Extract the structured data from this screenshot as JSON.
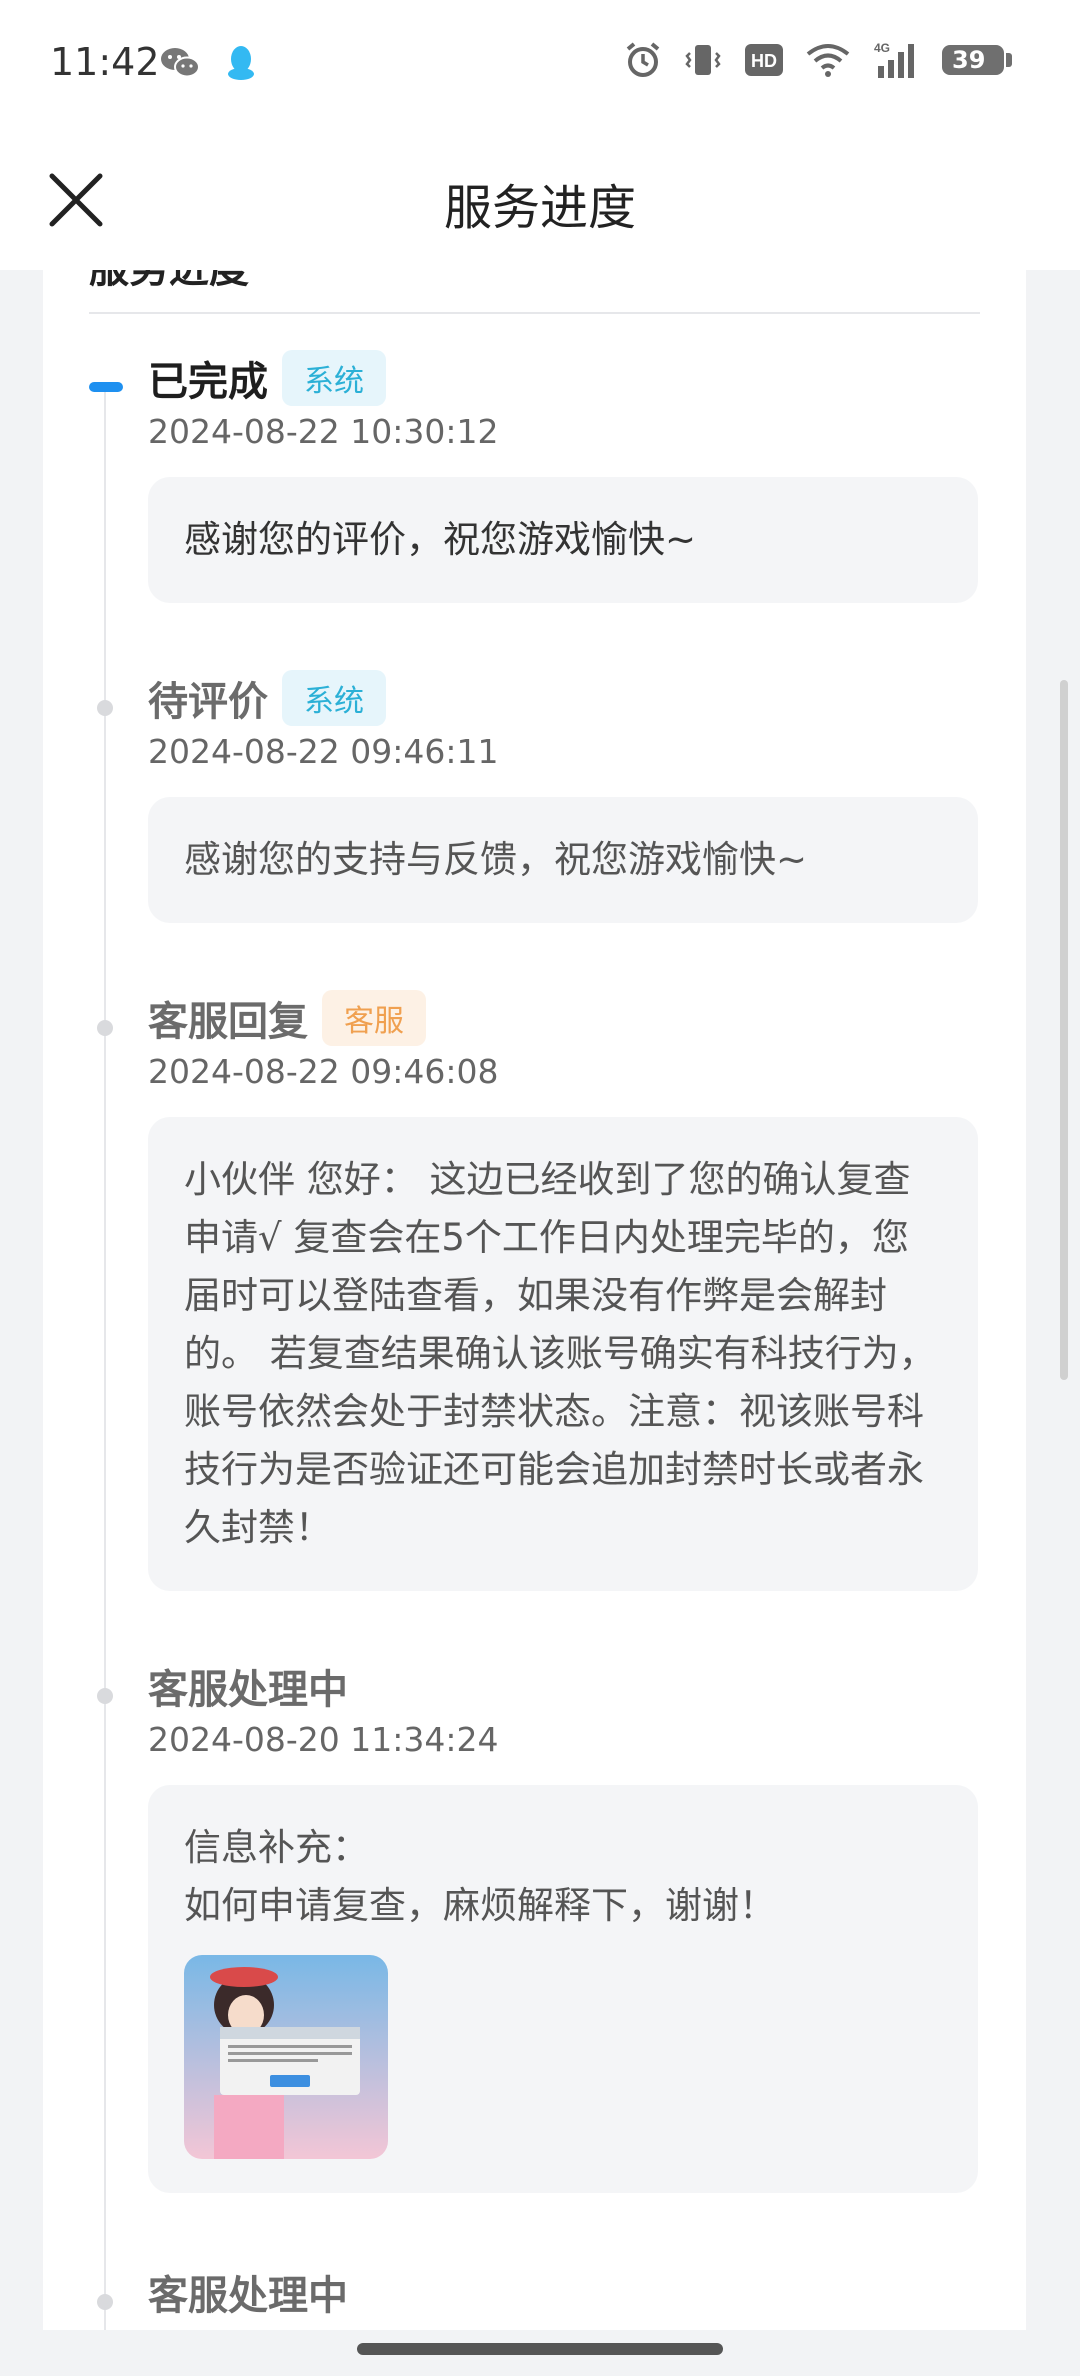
{
  "status_bar": {
    "time": "11:42",
    "left_icons": [
      "wechat-icon",
      "qq-icon"
    ],
    "right_icons": [
      "alarm-icon",
      "vibrate-icon",
      "hd-icon",
      "wifi-icon",
      "signal-4g-icon"
    ],
    "hd_label": "HD",
    "network_label": "4G",
    "battery": "39"
  },
  "header": {
    "title": "服务进度",
    "close_icon": "close-icon"
  },
  "card": {
    "section_heading": "服务进度"
  },
  "timeline": [
    {
      "status": "已完成",
      "tag": "系统",
      "tag_type": "system",
      "time": "2024-08-22 10:30:12",
      "message": "感谢您的评价，祝您游戏愉快~",
      "active": true
    },
    {
      "status": "待评价",
      "tag": "系统",
      "tag_type": "system",
      "time": "2024-08-22 09:46:11",
      "message": "感谢您的支持与反馈，祝您游戏愉快~",
      "active": false
    },
    {
      "status": "客服回复",
      "tag": "客服",
      "tag_type": "service",
      "time": "2024-08-22 09:46:08",
      "message": "小伙伴 您好： 这边已经收到了您的确认复查申请√ 复查会在5个工作日内处理完毕的，您届时可以登陆查看，如果没有作弊是会解封的。 若复查结果确认该账号确实有科技行为，账号依然会处于封禁状态。注意：视该账号科技行为是否验证还可能会追加封禁时长或者永久封禁！",
      "active": false
    },
    {
      "status": "客服处理中",
      "tag": "",
      "time": "2024-08-20 11:34:24",
      "message_label": "信息补充：",
      "message": "如何申请复查，麻烦解释下，谢谢！",
      "has_image": true,
      "active": false
    },
    {
      "status": "客服处理中",
      "tag": "",
      "active": false
    }
  ],
  "colors": {
    "accent": "#1e90f0",
    "system_tag_bg": "#e6f5fb",
    "system_tag_text": "#2bb0d6",
    "service_tag_bg": "#fdf1e5",
    "service_tag_text": "#f0a050",
    "page_bg": "#f2f3f5"
  }
}
